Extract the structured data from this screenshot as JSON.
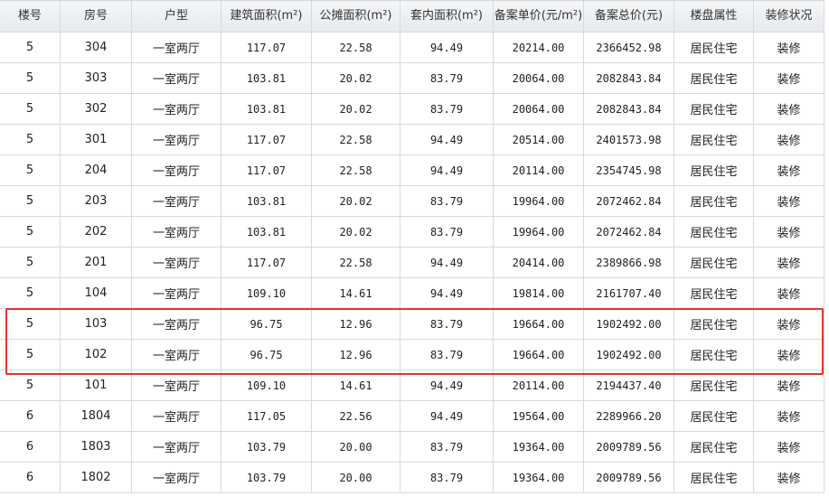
{
  "headers": [
    "楼号",
    "房号",
    "户型",
    "建筑面积(m²)",
    "公摊面积(m²)",
    "套内面积(m²)",
    "备案单价(元/m²)",
    "备案总价(元)",
    "楼盘属性",
    "装修状况"
  ],
  "rows": [
    [
      "5",
      "304",
      "一室两厅",
      "117.07",
      "22.58",
      "94.49",
      "20214.00",
      "2366452.98",
      "居民住宅",
      "装修"
    ],
    [
      "5",
      "303",
      "一室两厅",
      "103.81",
      "20.02",
      "83.79",
      "20064.00",
      "2082843.84",
      "居民住宅",
      "装修"
    ],
    [
      "5",
      "302",
      "一室两厅",
      "103.81",
      "20.02",
      "83.79",
      "20064.00",
      "2082843.84",
      "居民住宅",
      "装修"
    ],
    [
      "5",
      "301",
      "一室两厅",
      "117.07",
      "22.58",
      "94.49",
      "20514.00",
      "2401573.98",
      "居民住宅",
      "装修"
    ],
    [
      "5",
      "204",
      "一室两厅",
      "117.07",
      "22.58",
      "94.49",
      "20114.00",
      "2354745.98",
      "居民住宅",
      "装修"
    ],
    [
      "5",
      "203",
      "一室两厅",
      "103.81",
      "20.02",
      "83.79",
      "19964.00",
      "2072462.84",
      "居民住宅",
      "装修"
    ],
    [
      "5",
      "202",
      "一室两厅",
      "103.81",
      "20.02",
      "83.79",
      "19964.00",
      "2072462.84",
      "居民住宅",
      "装修"
    ],
    [
      "5",
      "201",
      "一室两厅",
      "117.07",
      "22.58",
      "94.49",
      "20414.00",
      "2389866.98",
      "居民住宅",
      "装修"
    ],
    [
      "5",
      "104",
      "一室两厅",
      "109.10",
      "14.61",
      "94.49",
      "19814.00",
      "2161707.40",
      "居民住宅",
      "装修"
    ],
    [
      "5",
      "103",
      "一室两厅",
      "96.75",
      "12.96",
      "83.79",
      "19664.00",
      "1902492.00",
      "居民住宅",
      "装修"
    ],
    [
      "5",
      "102",
      "一室两厅",
      "96.75",
      "12.96",
      "83.79",
      "19664.00",
      "1902492.00",
      "居民住宅",
      "装修"
    ],
    [
      "5",
      "101",
      "一室两厅",
      "109.10",
      "14.61",
      "94.49",
      "20114.00",
      "2194437.40",
      "居民住宅",
      "装修"
    ],
    [
      "6",
      "1804",
      "一室两厅",
      "117.05",
      "22.56",
      "94.49",
      "19564.00",
      "2289966.20",
      "居民住宅",
      "装修"
    ],
    [
      "6",
      "1803",
      "一室两厅",
      "103.79",
      "20.00",
      "83.79",
      "19364.00",
      "2009789.56",
      "居民住宅",
      "装修"
    ],
    [
      "6",
      "1802",
      "一室两厅",
      "103.79",
      "20.00",
      "83.79",
      "19364.00",
      "2009789.56",
      "居民住宅",
      "装修"
    ]
  ],
  "highlight_color": "#e8322e"
}
